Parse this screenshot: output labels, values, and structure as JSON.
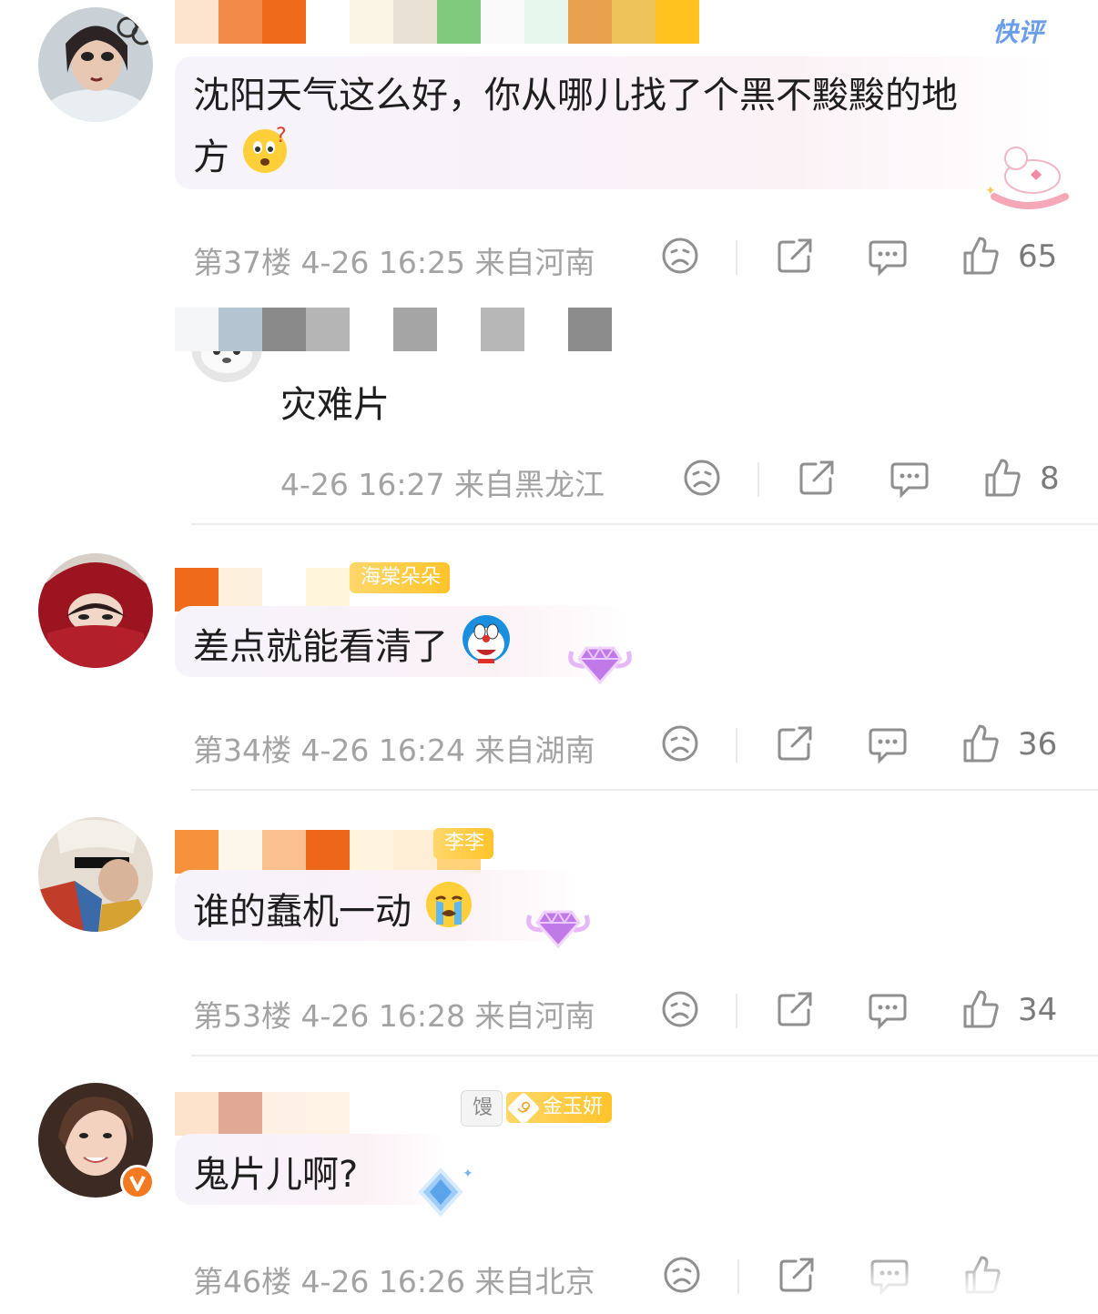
{
  "comments": [
    {
      "id": "c1",
      "text": "沈阳天气这么好，你从哪儿找了个黑不黢黢的地方",
      "text_line1": "沈阳天气这么好，你从哪儿找了个黑不黢黢的地",
      "text_line2": "方",
      "floor": "第37楼",
      "time": "4-26 16:25",
      "location": "来自河南",
      "likes": "65",
      "tag": "快评",
      "name_colors": [
        "#fde4cf",
        "#f28a4a",
        "#f06a1c",
        "#ffffff",
        "#fbf5e6",
        "#e9e1d4",
        "#7fca7c",
        "#fafafa",
        "#e7f6ec",
        "#e8a24f",
        "#eec45a",
        "#ffc21e"
      ],
      "avatar_color": "#b9c2c8",
      "reply": {
        "text": "灾难片",
        "time": "4-26 16:27",
        "location": "来自黑龙江",
        "likes": "8",
        "name_colors": [
          "#f4f6f8",
          "#b4c4d0",
          "#8a8a8a",
          "#b5b5b5",
          "#ffffff",
          "#a5a5a5",
          "#ffffff",
          "#b7b7b7",
          "#ffffff",
          "#8c8c8c"
        ]
      }
    },
    {
      "id": "c2",
      "text": "差点就能看清了",
      "floor": "第34楼",
      "time": "4-26 16:24",
      "location": "来自湖南",
      "likes": "36",
      "badge": "海棠朵朵",
      "name_colors": [
        "#f06a1c",
        "#fdf1de",
        "#ffffff",
        "#fff6dc"
      ],
      "avatar_color": "#8e1218"
    },
    {
      "id": "c3",
      "text": "谁的蠢机一动",
      "floor": "第53楼",
      "time": "4-26 16:28",
      "location": "来自河南",
      "likes": "34",
      "badge": "李李",
      "name_colors": [
        "#f7923c",
        "#fdf6ea",
        "#fbc08f",
        "#ee661a",
        "#fff4de",
        "#fdeed5",
        "#ffd27a"
      ],
      "avatar_color": "#d8c9b8"
    },
    {
      "id": "c4",
      "text": "鬼片儿啊?",
      "floor": "第46楼",
      "time": "4-26 16:26",
      "location": "来自北京",
      "likes": "",
      "badge_gray": "馒",
      "badge_level": "9",
      "badge_name": "金玉妍",
      "name_colors": [
        "#fde3cc",
        "#e2a896",
        "#fdf1e6",
        "#fff4e6",
        "#ffffff"
      ],
      "avatar_color": "#5a4034"
    }
  ],
  "colors": {
    "meta_text": "#a3a3a3",
    "badge_yellow": "#ffc42a",
    "verified_orange": "#f47a21",
    "quick_review_blue": "#6b9ee8"
  },
  "icons": [
    "sad-face-icon",
    "share-icon",
    "comment-icon",
    "thumbs-up-icon",
    "verified-icon",
    "diamond-badge-icon",
    "unicorn-decoration-icon"
  ]
}
